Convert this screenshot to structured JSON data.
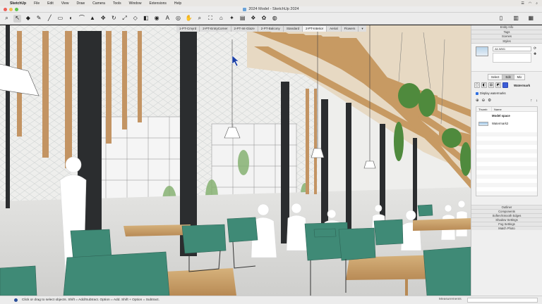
{
  "menubar": {
    "items": [
      "SketchUp",
      "File",
      "Edit",
      "View",
      "Draw",
      "Camera",
      "Tools",
      "Window",
      "Extensions",
      "Help"
    ]
  },
  "window": {
    "title": "2024 Model - SketchUp 2024"
  },
  "toolbar": {
    "tools": [
      {
        "name": "search-icon",
        "glyph": "⌕"
      },
      {
        "name": "select-tool-icon",
        "glyph": "↖"
      },
      {
        "name": "tape-tool-icon",
        "glyph": "◆"
      },
      {
        "name": "pencil-tool-icon",
        "glyph": "✎"
      },
      {
        "name": "line-tool-icon",
        "glyph": "╱"
      },
      {
        "name": "rectangle-tool-icon",
        "glyph": "▭"
      },
      {
        "name": "circle-tool-icon",
        "glyph": "◐"
      },
      {
        "name": "arc-tool-icon",
        "glyph": "⌒"
      },
      {
        "name": "push-pull-tool-icon",
        "glyph": "▲"
      },
      {
        "name": "move-tool-icon",
        "glyph": "✥"
      },
      {
        "name": "rotate-tool-icon",
        "glyph": "↻"
      },
      {
        "name": "scale-tool-icon",
        "glyph": "⤢"
      },
      {
        "name": "offset-tool-icon",
        "glyph": "◇"
      },
      {
        "name": "eraser-tool-icon",
        "glyph": "◧"
      },
      {
        "name": "paint-tool-icon",
        "glyph": "◉"
      },
      {
        "name": "text-tool-icon",
        "glyph": "A"
      },
      {
        "name": "orbit-tool-icon",
        "glyph": "◎"
      },
      {
        "name": "pan-tool-icon",
        "glyph": "✋"
      },
      {
        "name": "zoom-tool-icon",
        "glyph": "⌕"
      },
      {
        "name": "zoom-extents-icon",
        "glyph": "⛶"
      },
      {
        "name": "warehouse-icon",
        "glyph": "⌂"
      },
      {
        "name": "extension-icon",
        "glyph": "✦"
      },
      {
        "name": "layout-icon",
        "glyph": "▤"
      },
      {
        "name": "scenes-icon",
        "glyph": "❖"
      },
      {
        "name": "styles-icon",
        "glyph": "✿"
      },
      {
        "name": "vr-icon",
        "glyph": "◍"
      }
    ],
    "right_icons": [
      "new-doc-icon",
      "panels-icon",
      "tray-icon"
    ],
    "active_index": 1
  },
  "scenes": {
    "tabs": [
      "1-PT-Cmyrd",
      "2-PT-EntryCorner",
      "2-PT-Int-Glaze",
      "2-PT-Balcony",
      "Standard",
      "2-PT-Interior",
      "Aerial",
      "Flowers"
    ],
    "selected": "2-PT-Interior",
    "more": "▾"
  },
  "tray": {
    "sections_top": [
      "Entity Info",
      "Tags",
      "Scenes",
      "Styles"
    ],
    "style_name": "All-WM1",
    "style_tabs": [
      "Select",
      "Edit",
      "Mix"
    ],
    "style_tab_selected": "Edit",
    "watermark_label": "Watermark",
    "display_watermarks": "Display watermarks",
    "table_headers": [
      "Thumb",
      "Name"
    ],
    "rows": [
      "Model space",
      "Watermark2"
    ],
    "sections_bottom": [
      "Outliner",
      "Components",
      "Soften/Smooth Edges",
      "Shadow Settings",
      "Fog Settings",
      "Match Photo"
    ]
  },
  "status": {
    "hint": "Click or drag to select objects. Shift = Add/Subtract. Option = Add. Shift + Option = Subtract.",
    "measurements_label": "Measurements"
  },
  "colors": {
    "accent": "#3d5ed8",
    "chair_green": "#3f8a76",
    "wood": "#c9a06b"
  }
}
